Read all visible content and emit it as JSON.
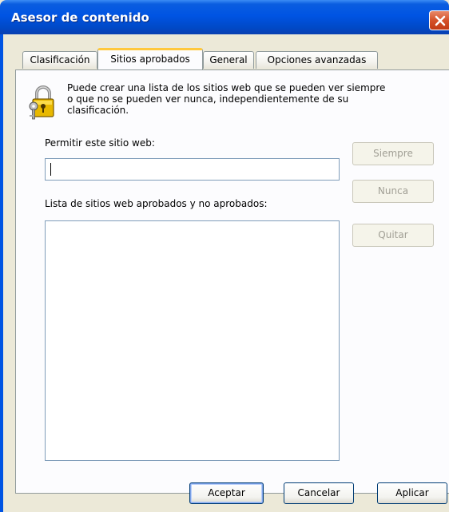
{
  "window": {
    "title": "Asesor de contenido"
  },
  "tabs": [
    {
      "label": "Clasificación"
    },
    {
      "label": "Sitios aprobados"
    },
    {
      "label": "General"
    },
    {
      "label": "Opciones avanzadas"
    }
  ],
  "active_tab": "Sitios aprobados",
  "approved_sites": {
    "info_line1": "Puede crear una lista de los sitios web que se pueden ver siempre",
    "info_line2": "o que no se pueden ver nunca, independientemente de su",
    "info_line3": "clasificación.",
    "allow_label": "Permitir este sitio web:",
    "allow_value": "",
    "list_label": "Lista de sitios web aprobados y no aprobados:",
    "list_items": [],
    "always_button": "Siempre",
    "never_button": "Nunca",
    "remove_button": "Quitar"
  },
  "footer": {
    "ok": "Aceptar",
    "cancel": "Cancelar",
    "apply": "Aplicar"
  },
  "icons": {
    "header": "lock-key-icon",
    "close": "close-icon"
  },
  "colors": {
    "titlebar": "#0054e3",
    "dialog_bg": "#ece9d8",
    "active_tab_accent": "#ffc83c",
    "close_button": "#d4512a"
  }
}
